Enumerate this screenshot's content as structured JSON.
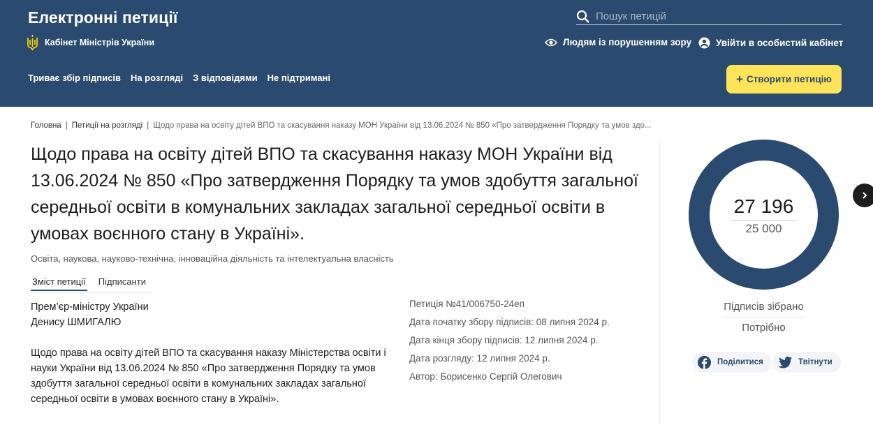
{
  "header": {
    "brand": "Електронні петиції",
    "government": "Кабінет Міністрів України",
    "search_placeholder": "Пошук петицій",
    "accessibility_link": "Людям із порушенням зору",
    "login_link": "Увійти в особистий кабінет",
    "nav": [
      "Триває збір підписів",
      "На розгляді",
      "З відповідями",
      "Не підтримані"
    ],
    "create_button": "Створити петицію",
    "background_color": "#2b4a6f",
    "accent_color": "#ffe358"
  },
  "breadcrumb": {
    "home": "Головна",
    "section": "Петиції на розгляді",
    "current": "Щодо права на освіту дітей ВПО та скасування наказу МОН України від 13.06.2024 № 850 «Про затвердження Порядку та умов здо..."
  },
  "petition": {
    "title": "Щодо права на освіту дітей ВПО та скасування наказу МОН України від 13.06.2024 № 850 «Про затвердження Порядку та умов здобуття загальної середньої освіти в комунальних закладах загальної середньої освіти в умовах воєнного стану в Україні».",
    "category": "Освіта, наукова, науково-технічна, інноваційна діяльність та інтелектуальна власність",
    "tabs": [
      "Зміст петиції",
      "Підписанти"
    ],
    "addressee_line1": "Прем’єр-міністру України",
    "addressee_line2": "Денису ШМИГАЛЮ",
    "body": "Щодо права на освіту дітей ВПО та скасування наказу Міністерства освіти і науки України від 13.06.2024 № 850 «Про затвердження Порядку та умов здобуття загальної середньої освіти в комунальних закладах загальної середньої освіти в умовах воєнного стану в Україні».",
    "meta": {
      "number": "Петиція №41/006750-24еп",
      "start_date": "Дата початку збору підписів: 08 липня 2024 р.",
      "end_date": "Дата кінця збору підписів: 12 липня 2024 р.",
      "review_date": "Дата розгляду: 12 липня 2024 р.",
      "author": "Автор: Борисенко Сергій Олегович"
    }
  },
  "stats": {
    "collected": "27 196",
    "required": "25 000",
    "collected_label": "Підписів зібрано",
    "required_label": "Потрібно",
    "share_facebook": "Поділитися",
    "share_twitter": "Твітнути"
  }
}
